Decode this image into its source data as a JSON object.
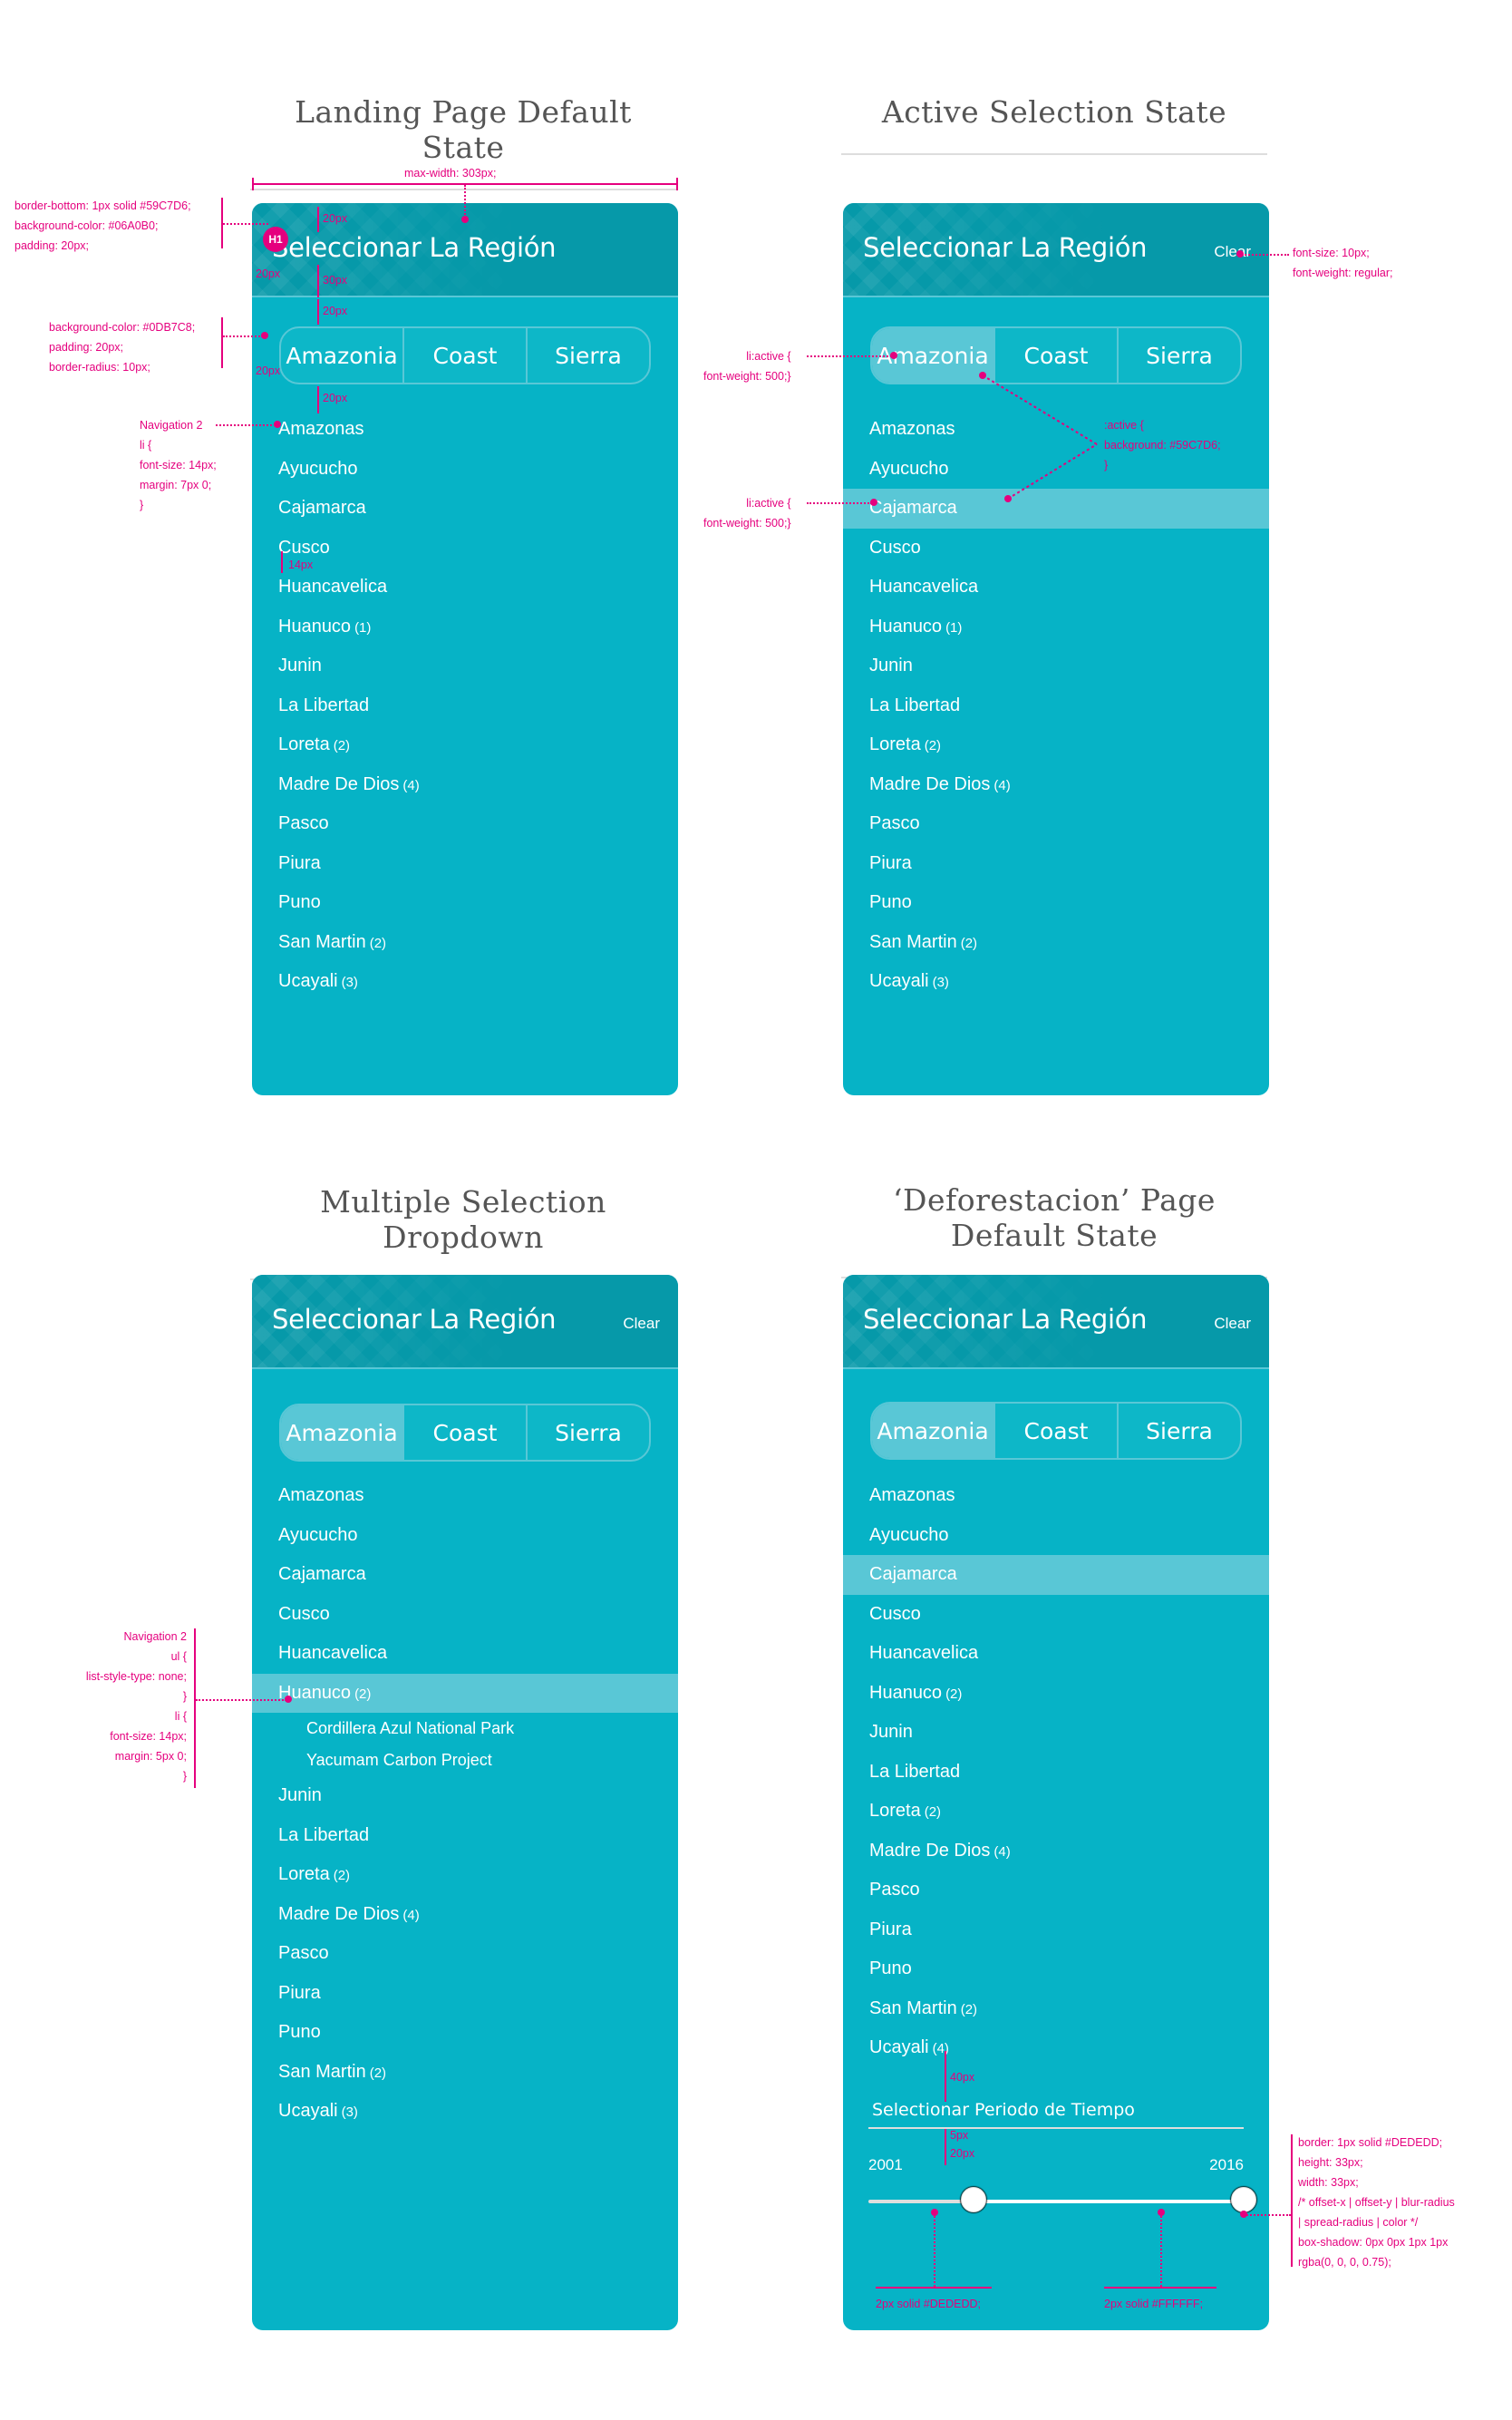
{
  "sections": {
    "landing": "Landing Page Default State",
    "active": "Active Selection State",
    "multiple": "Multiple Selection Dropdown",
    "deforestacion": "‘Deforestacion’ Page Default State"
  },
  "panel": {
    "title": "Seleccionar La Región",
    "clear_label": "Clear",
    "tabs": [
      "Amazonia",
      "Coast",
      "Sierra"
    ],
    "active_tab": "Amazonia"
  },
  "regions": [
    {
      "name": "Amazonas",
      "count": ""
    },
    {
      "name": "Ayucucho",
      "count": ""
    },
    {
      "name": "Cajamarca",
      "count": ""
    },
    {
      "name": "Cusco",
      "count": ""
    },
    {
      "name": "Huancavelica",
      "count": ""
    },
    {
      "name": "Huanuco",
      "count": "(1)"
    },
    {
      "name": "Junin",
      "count": ""
    },
    {
      "name": "La Libertad",
      "count": ""
    },
    {
      "name": "Loreta",
      "count": "(2)"
    },
    {
      "name": "Madre De Dios",
      "count": "(4)"
    },
    {
      "name": "Pasco",
      "count": ""
    },
    {
      "name": "Piura",
      "count": ""
    },
    {
      "name": "Puno",
      "count": ""
    },
    {
      "name": "San Martin",
      "count": "(2)"
    },
    {
      "name": "Ucayali",
      "count": "(3)"
    }
  ],
  "regions_multi": [
    {
      "name": "Amazonas",
      "count": ""
    },
    {
      "name": "Ayucucho",
      "count": ""
    },
    {
      "name": "Cajamarca",
      "count": ""
    },
    {
      "name": "Cusco",
      "count": ""
    },
    {
      "name": "Huancavelica",
      "count": ""
    },
    {
      "name": "Huanuco",
      "count": "(2)",
      "active": true,
      "children": [
        "Cordillera Azul National Park",
        "Yacumam Carbon Project"
      ]
    },
    {
      "name": "Junin",
      "count": ""
    },
    {
      "name": "La Libertad",
      "count": ""
    },
    {
      "name": "Loreta",
      "count": "(2)"
    },
    {
      "name": "Madre De Dios",
      "count": "(4)"
    },
    {
      "name": "Pasco",
      "count": ""
    },
    {
      "name": "Piura",
      "count": ""
    },
    {
      "name": "Puno",
      "count": ""
    },
    {
      "name": "San Martin",
      "count": "(2)"
    },
    {
      "name": "Ucayali",
      "count": "(3)"
    }
  ],
  "regions_defor": [
    {
      "name": "Amazonas",
      "count": ""
    },
    {
      "name": "Ayucucho",
      "count": ""
    },
    {
      "name": "Cajamarca",
      "count": "",
      "active": true
    },
    {
      "name": "Cusco",
      "count": ""
    },
    {
      "name": "Huancavelica",
      "count": ""
    },
    {
      "name": "Huanuco",
      "count": "(2)"
    },
    {
      "name": "Junin",
      "count": ""
    },
    {
      "name": "La Libertad",
      "count": ""
    },
    {
      "name": "Loreta",
      "count": "(2)"
    },
    {
      "name": "Madre De Dios",
      "count": "(4)"
    },
    {
      "name": "Pasco",
      "count": ""
    },
    {
      "name": "Piura",
      "count": ""
    },
    {
      "name": "Puno",
      "count": ""
    },
    {
      "name": "San Martin",
      "count": "(2)"
    },
    {
      "name": "Ucayali",
      "count": "(4)"
    }
  ],
  "time": {
    "label": "Selectionar Periodo de Tiempo",
    "start_year": "2001",
    "end_year": "2016",
    "range_start_fraction": 0.0,
    "range_end_fraction": 1.0,
    "handle_positions": [
      0.28,
      1.0
    ]
  },
  "annotations": {
    "max_width": "max-width: 303px;",
    "header_css": [
      "border-bottom: 1px solid #59C7D6;",
      "background-color: #06A0B0;",
      "padding: 20px;"
    ],
    "seg_css": [
      "background-color: #0DB7C8;",
      "padding: 20px;",
      "border-radius: 10px;"
    ],
    "nav2_css": [
      "Navigation 2",
      "li {",
      "font-size: 14px;",
      "margin: 7px 0;",
      "}"
    ],
    "nav2_ul_css": [
      "Navigation 2",
      "ul {",
      "list-style-type: none;",
      "}",
      "li {",
      "font-size: 14px;",
      "margin: 5px 0;",
      "}"
    ],
    "clear_css": [
      "font-size: 10px;",
      "font-weight: regular;"
    ],
    "li_active_css": [
      "li:active {",
      "font-weight: 500;}"
    ],
    "active_bg_css": [
      ":active {",
      "background: #59C7D6;",
      "}"
    ],
    "thumb_css": [
      "border: 1px solid #DEDEDD;",
      "height: 33px;",
      "width: 33px;",
      "/* offset-x | offset-y | blur-radius",
      " | spread-radius | color */",
      "box-shadow: 0px 0px 1px 1px",
      "rgba(0, 0, 0, 0.75);"
    ],
    "track_bg_css": "2px solid #DEDEDD;",
    "track_fill_css": "2px solid #FFFFFF;",
    "spacing": {
      "p20": "20px",
      "p30": "30px",
      "p14": "14px",
      "p40": "40px",
      "p5": "5px"
    },
    "h1_badge": "H1"
  },
  "colors": {
    "panel_bg": "#06B3C6",
    "header_bg": "#0699A9",
    "active_bg": "#59C7D6",
    "annotation": "#E5007E"
  }
}
